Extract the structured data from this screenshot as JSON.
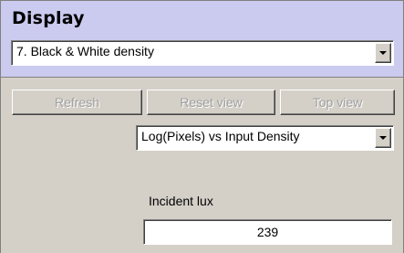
{
  "display": {
    "title": "Display",
    "selected_option": "7.  Black & White density"
  },
  "toolbar": {
    "refresh_label": "Refresh",
    "reset_view_label": "Reset view",
    "top_view_label": "Top view"
  },
  "plot_mode": {
    "selected_option": "Log(Pixels) vs Input Density"
  },
  "incident_lux": {
    "label": "Incident lux",
    "value": "239"
  }
}
